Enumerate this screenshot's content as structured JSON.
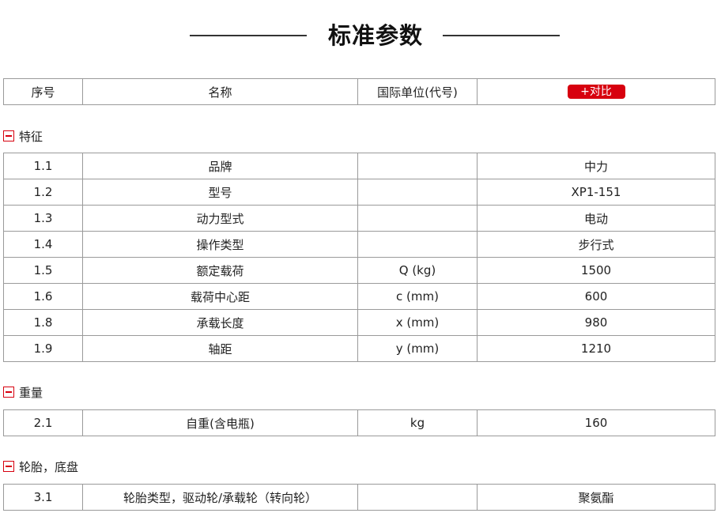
{
  "page": {
    "title": "标准参数"
  },
  "header_row": {
    "col1": "序号",
    "col2": "名称",
    "col3": "国际单位(代号)",
    "compare_label": "+对比"
  },
  "sections": [
    {
      "label": "特征",
      "rows": [
        {
          "no": "1.1",
          "name": "品牌",
          "unit": "",
          "value": "中力"
        },
        {
          "no": "1.2",
          "name": "型号",
          "unit": "",
          "value": "XP1-151"
        },
        {
          "no": "1.3",
          "name": "动力型式",
          "unit": "",
          "value": "电动"
        },
        {
          "no": "1.4",
          "name": "操作类型",
          "unit": "",
          "value": "步行式"
        },
        {
          "no": "1.5",
          "name": "额定载荷",
          "unit": "Q (kg)",
          "value": "1500"
        },
        {
          "no": "1.6",
          "name": "载荷中心距",
          "unit": "c (mm)",
          "value": "600"
        },
        {
          "no": "1.8",
          "name": "承载长度",
          "unit": "x (mm)",
          "value": "980"
        },
        {
          "no": "1.9",
          "name": "轴距",
          "unit": "y (mm)",
          "value": "1210"
        }
      ]
    },
    {
      "label": "重量",
      "rows": [
        {
          "no": "2.1",
          "name": "自重(含电瓶)",
          "unit": "kg",
          "value": "160"
        }
      ]
    },
    {
      "label": "轮胎，底盘",
      "rows": [
        {
          "no": "3.1",
          "name": "轮胎类型，驱动轮/承载轮（转向轮）",
          "unit": "",
          "value": "聚氨酯"
        }
      ]
    }
  ],
  "colors": {
    "accent": "#d7000f",
    "border": "#9a9a9a"
  }
}
